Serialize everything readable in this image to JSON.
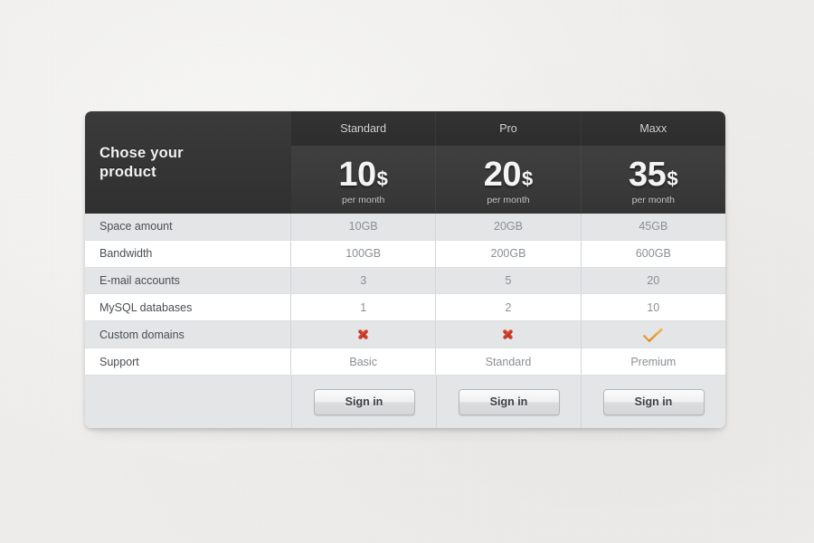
{
  "header": {
    "title": "Chose your product",
    "plans": [
      {
        "name": "Standard",
        "amount": "10",
        "currency": "$",
        "period": "per month"
      },
      {
        "name": "Pro",
        "amount": "20",
        "currency": "$",
        "period": "per month"
      },
      {
        "name": "Maxx",
        "amount": "35",
        "currency": "$",
        "period": "per month"
      }
    ]
  },
  "rows": [
    {
      "label": "Space amount",
      "values": [
        "10GB",
        "20GB",
        "45GB"
      ],
      "type": "text"
    },
    {
      "label": "Bandwidth",
      "values": [
        "100GB",
        "200GB",
        "600GB"
      ],
      "type": "text"
    },
    {
      "label": "E-mail accounts",
      "values": [
        "3",
        "5",
        "20"
      ],
      "type": "text"
    },
    {
      "label": "MySQL databases",
      "values": [
        "1",
        "2",
        "10"
      ],
      "type": "text"
    },
    {
      "label": "Custom domains",
      "values": [
        "cross-icon",
        "cross-icon",
        "check-icon"
      ],
      "type": "icon"
    },
    {
      "label": "Support",
      "values": [
        "Basic",
        "Standard",
        "Premium"
      ],
      "type": "text"
    }
  ],
  "footer": {
    "buttons": [
      "Sign in",
      "Sign in",
      "Sign in"
    ]
  },
  "colors": {
    "header_dark": "#3b3b3b",
    "header_names": "#333333",
    "row_alt": "#e3e5e7",
    "row_base": "#ffffff",
    "label_text": "#4a4e52",
    "value_text": "#8b8f93",
    "cross_red": "#cc3a28",
    "check_orange": "#e8a13c",
    "page_bg": "#efeeec"
  }
}
